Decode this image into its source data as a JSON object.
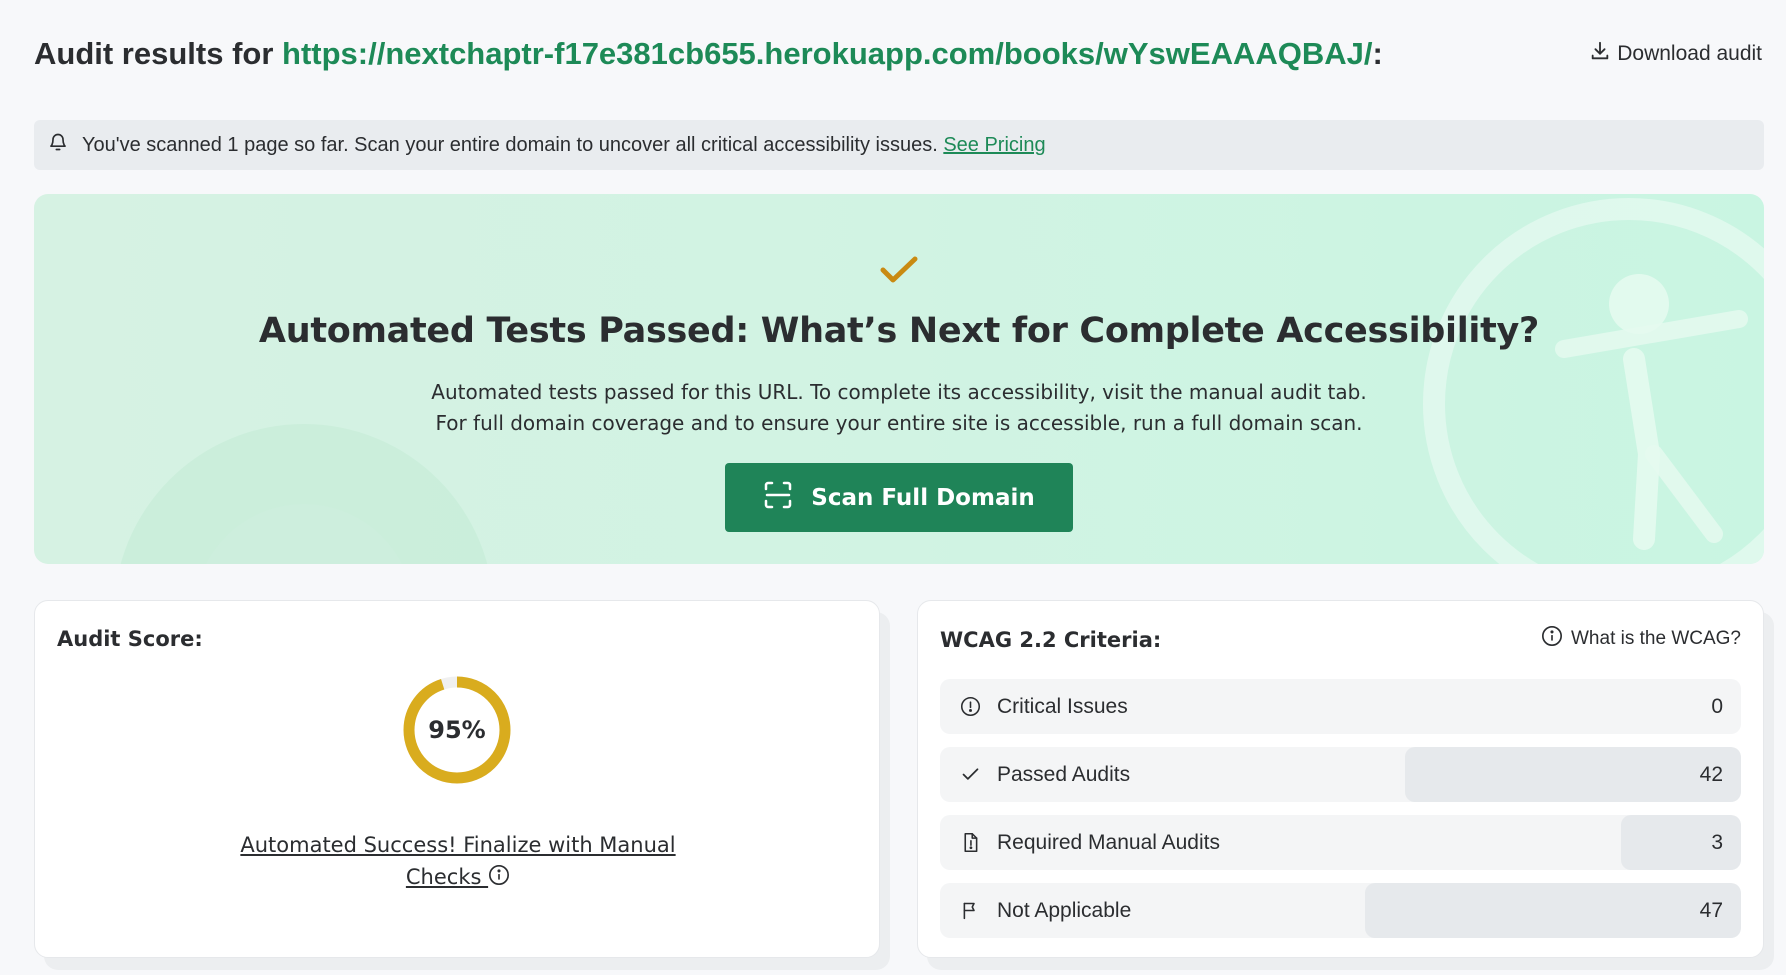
{
  "header": {
    "title_prefix": "Audit results for ",
    "url": "https://nextchaptr-f17e381cb655.herokuapp.com/books/wYswEAAAQBAJ/",
    "title_suffix": ":",
    "download_label": "Download audit",
    "download_icon": "download-icon"
  },
  "notice": {
    "icon": "bell-icon",
    "text": "You've scanned 1 page so far. Scan your entire domain to uncover all critical accessibility issues.",
    "link_label": "See Pricing"
  },
  "hero": {
    "icon": "checkmark-icon",
    "title": "Automated Tests Passed: What’s Next for Complete Accessibility?",
    "line1": "Automated tests passed for this URL. To complete its accessibility, visit the manual audit tab.",
    "line2": "For full domain coverage and to ensure your entire site is accessible, run a full domain scan.",
    "button_label": "Scan Full Domain",
    "button_icon": "scan-icon"
  },
  "score": {
    "label": "Audit Score:",
    "value": "95%",
    "percent": 95,
    "link_label": "Automated Success! Finalize with Manual Checks "
  },
  "wcag": {
    "label": "WCAG 2.2 Criteria:",
    "help_label": "What is the WCAG?",
    "rows": [
      {
        "label": "Critical Issues",
        "value": "0",
        "icon": "alert-circle-icon",
        "fraction": 0
      },
      {
        "label": "Passed Audits",
        "value": "42",
        "icon": "check-icon",
        "fraction": 0.42
      },
      {
        "label": "Required Manual Audits",
        "value": "3",
        "icon": "document-icon",
        "fraction": 0.15
      },
      {
        "label": "Not Applicable",
        "value": "47",
        "icon": "flag-icon",
        "fraction": 0.47
      }
    ]
  },
  "colors": {
    "accent": "#1d8a57",
    "gauge": "#d9ac1e",
    "check": "#c98a12"
  }
}
